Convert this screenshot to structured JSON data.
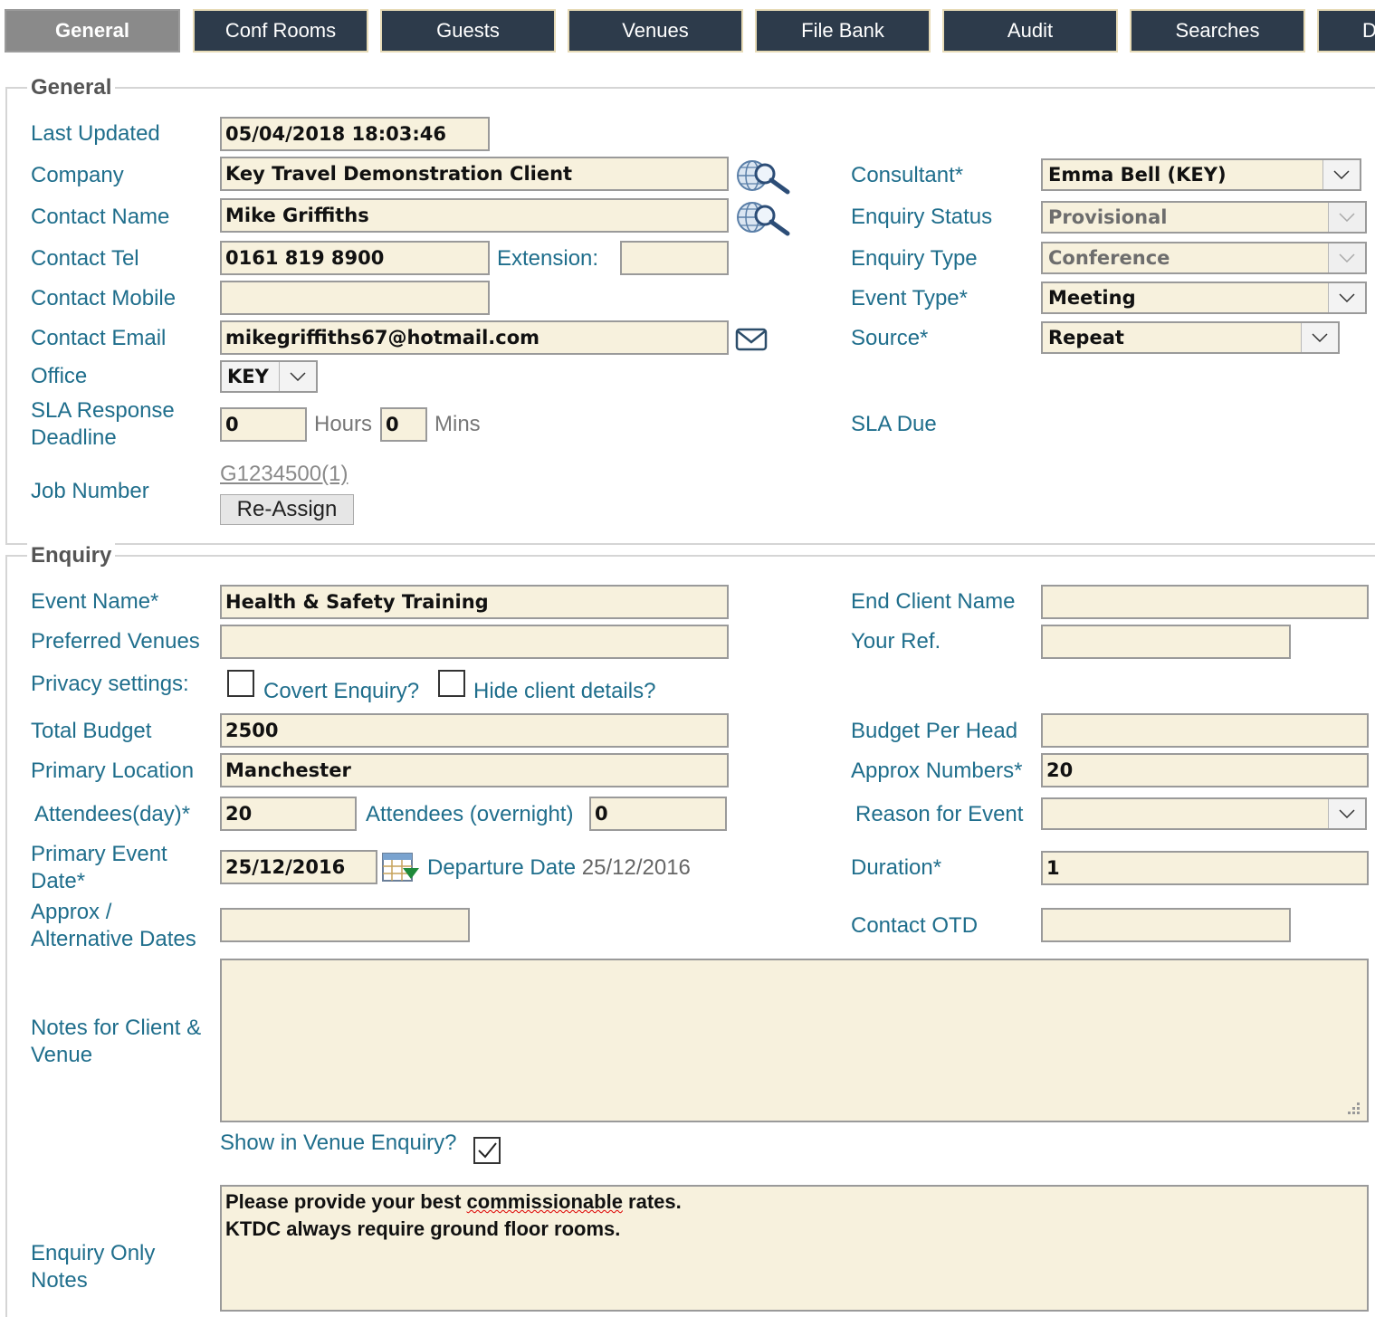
{
  "tabs": [
    "General",
    "Conf Rooms",
    "Guests",
    "Venues",
    "File Bank",
    "Audit",
    "Searches",
    "D"
  ],
  "general": {
    "legend": "General",
    "last_updated_label": "Last Updated",
    "last_updated": "05/04/2018 18:03:46",
    "company_label": "Company",
    "company": "Key Travel Demonstration Client",
    "contact_name_label": "Contact Name",
    "contact_name": "Mike Griffiths",
    "contact_tel_label": "Contact Tel",
    "contact_tel": "0161 819 8900",
    "extension_label": "Extension:",
    "extension": "",
    "contact_mobile_label": "Contact Mobile",
    "contact_mobile": "",
    "contact_email_label": "Contact Email",
    "contact_email": "mikegriffiths67@hotmail.com",
    "office_label": "Office",
    "office": "KEY",
    "sla_label": "SLA Response Deadline",
    "sla_hours": "0",
    "hours_label": "Hours",
    "sla_mins": "0",
    "mins_label": "Mins",
    "job_number_label": "Job Number",
    "job_number": "G1234500(1)",
    "reassign_label": "Re-Assign",
    "consultant_label": "Consultant*",
    "consultant": "Emma Bell (KEY)",
    "enquiry_status_label": "Enquiry Status",
    "enquiry_status": "Provisional",
    "enquiry_type_label": "Enquiry Type",
    "enquiry_type": "Conference",
    "event_type_label": "Event Type*",
    "event_type": "Meeting",
    "source_label": "Source*",
    "source": "Repeat",
    "sla_due_label": "SLA Due"
  },
  "enquiry": {
    "legend": "Enquiry",
    "event_name_label": "Event Name*",
    "event_name": "Health & Safety Training",
    "preferred_venues_label": "Preferred Venues",
    "preferred_venues": "",
    "privacy_label": "Privacy settings:",
    "covert_label": "Covert Enquiry?",
    "hide_client_label": "Hide client details?",
    "total_budget_label": "Total Budget",
    "total_budget": "2500",
    "primary_location_label": "Primary Location",
    "primary_location": "Manchester",
    "attendees_day_label": "Attendees(day)*",
    "attendees_day": "20",
    "attendees_overnight_label": "Attendees (overnight)",
    "attendees_overnight": "0",
    "primary_event_date_label": "Primary Event Date*",
    "primary_event_date": "25/12/2016",
    "departure_date_label": "Departure Date",
    "departure_date": "25/12/2016",
    "approx_dates_label": "Approx / Alternative Dates",
    "approx_dates": "",
    "notes_label": "Notes for Client & Venue",
    "notes": "",
    "show_in_venue_label": "Show in Venue Enquiry?",
    "show_in_venue_checked": true,
    "enquiry_only_notes_label": "Enquiry Only Notes",
    "enquiry_only_notes_line1_a": "Please provide your best ",
    "enquiry_only_notes_line1_word": "commissionable",
    "enquiry_only_notes_line1_b": " rates.",
    "enquiry_only_notes_line2": "KTDC always require ground floor rooms.",
    "end_client_label": "End Client Name",
    "end_client": "",
    "your_ref_label": "Your Ref.",
    "your_ref": "",
    "budget_per_head_label": "Budget Per Head",
    "budget_per_head": "",
    "approx_numbers_label": "Approx Numbers*",
    "approx_numbers": "20",
    "reason_label": "Reason for Event",
    "reason": "",
    "duration_label": "Duration*",
    "duration": "1",
    "contact_otd_label": "Contact OTD",
    "contact_otd": ""
  },
  "icons": [
    "globe-search-icon",
    "mail-icon",
    "calendar-icon",
    "chevron-down-icon",
    "checkmark-icon",
    "resize-grip-icon"
  ]
}
